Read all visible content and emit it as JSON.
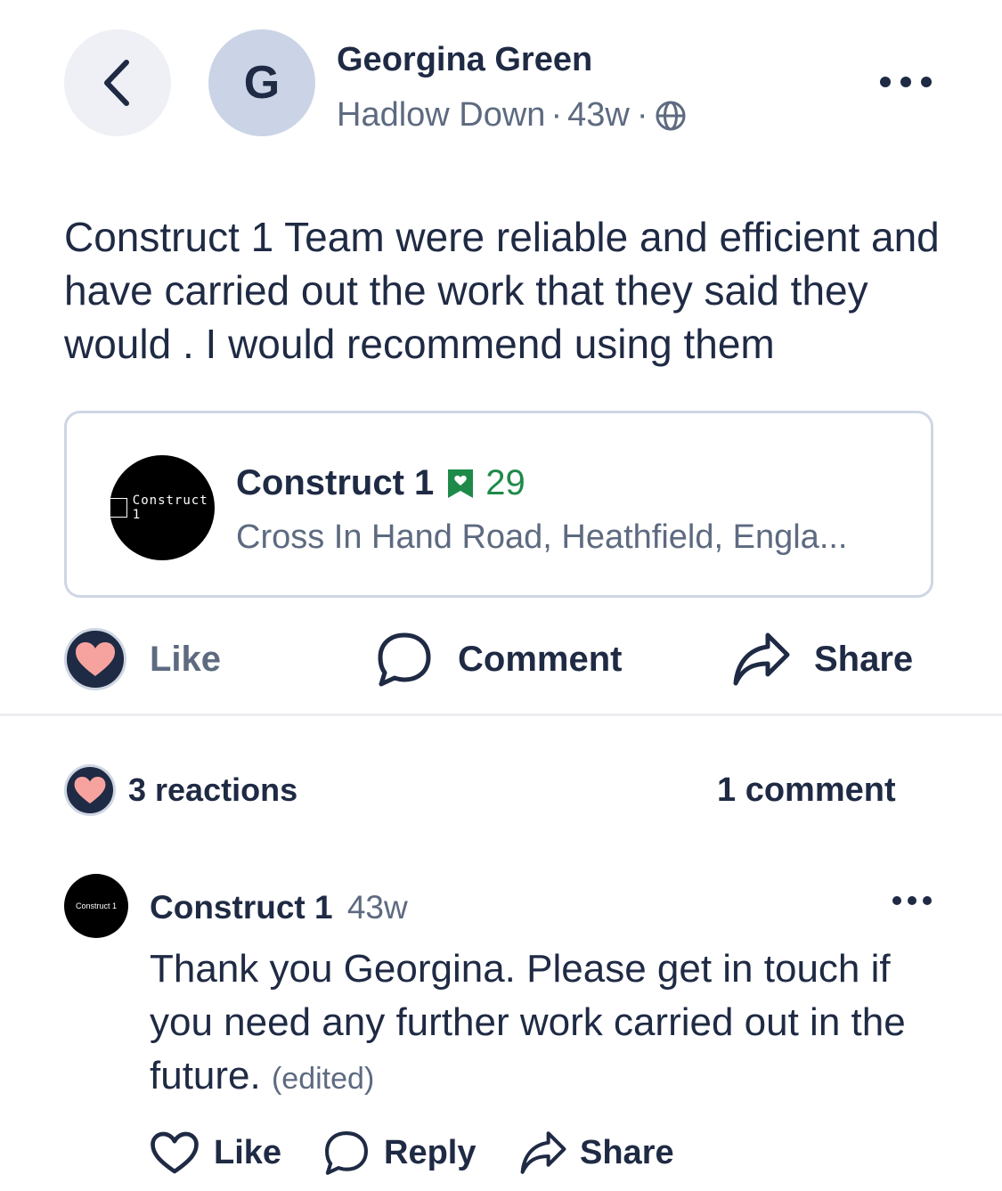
{
  "header": {
    "avatar_letter": "G",
    "author_name": "Georgina Green",
    "location": "Hadlow Down",
    "time": "43w",
    "separator": "·"
  },
  "post": {
    "body": "Construct 1 Team were reliable and efficient and have carried out the work that they said they would . I would recommend using them"
  },
  "business": {
    "name": "Construct 1",
    "rating_count": "29",
    "address": "Cross In Hand Road, Heathfield,  Engla...",
    "logo_text": "Construct 1"
  },
  "actions": {
    "like": "Like",
    "comment": "Comment",
    "share": "Share"
  },
  "summary": {
    "reactions": "3 reactions",
    "comments": "1 comment"
  },
  "comment": {
    "author": "Construct 1",
    "time": "43w",
    "body": "Thank you Georgina. Please get in touch if you need any further work carried out in the future.",
    "edited": "(edited)",
    "logo_text": "Construct 1",
    "actions": {
      "like": "Like",
      "reply": "Reply",
      "share": "Share"
    }
  },
  "colors": {
    "text": "#1f2a44",
    "muted": "#5d6a80",
    "heart": "#f6a3a0",
    "rating_green": "#1e8a4a"
  }
}
